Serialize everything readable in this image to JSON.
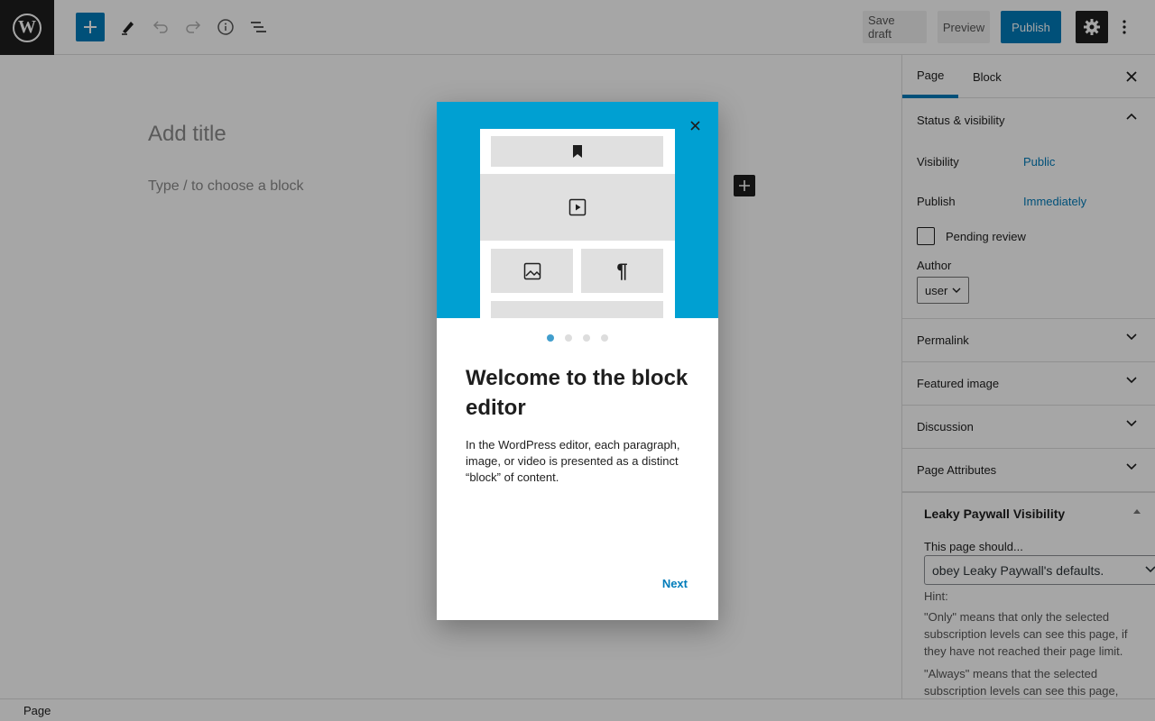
{
  "topbar": {
    "logo_icon": "wordpress-logo-icon",
    "logo_glyph": "W",
    "save_draft": "Save draft",
    "preview": "Preview",
    "publish": "Publish"
  },
  "canvas": {
    "title_placeholder": "Add title",
    "block_placeholder": "Type / to choose a block"
  },
  "sidebar": {
    "tabs": [
      {
        "label": "Page",
        "active": true
      },
      {
        "label": "Block",
        "active": false
      }
    ],
    "status": {
      "heading": "Status & visibility",
      "visibility_label": "Visibility",
      "visibility_value": "Public",
      "publish_label": "Publish",
      "publish_value": "Immediately",
      "pending_label": "Pending review",
      "author_label": "Author",
      "author_value": "user"
    },
    "panels": [
      "Permalink",
      "Featured image",
      "Discussion",
      "Page Attributes"
    ],
    "paywall": {
      "heading": "Leaky Paywall Visibility",
      "label": "This page should...",
      "select_value": "obey Leaky Paywall's defaults.",
      "hint": "Hint:",
      "text1": "\"Only\" means that only the selected subscription levels can see this page, if they have not reached their page limit.",
      "text2": "\"Always\" means that the selected subscription levels can see this page,"
    }
  },
  "statusbar": {
    "label": "Page"
  },
  "modal": {
    "title": "Welcome to the block editor",
    "body": "In the WordPress editor, each paragraph, image, or video is presented as a distinct “block” of content.",
    "next": "Next",
    "paragraph_glyph": "¶",
    "page_count": 4,
    "current_page": 1
  },
  "colors": {
    "accent": "#007cba",
    "hero": "#00a0d2",
    "dark": "#1e1e1e"
  }
}
